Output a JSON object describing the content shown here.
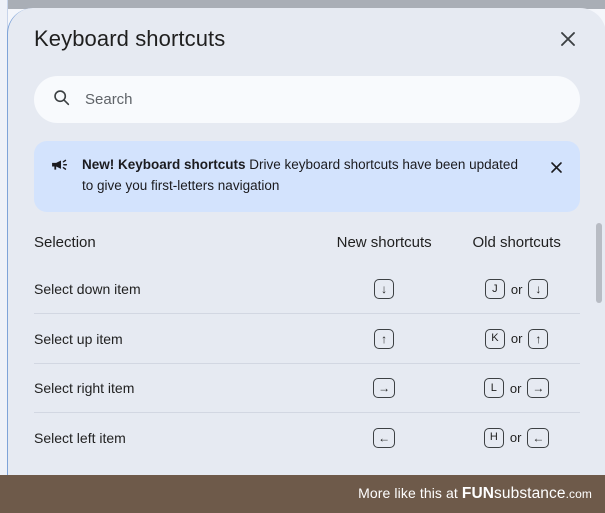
{
  "dialog": {
    "title": "Keyboard shortcuts",
    "close_label": "×",
    "close_icon": "close-icon"
  },
  "search": {
    "placeholder": "Search",
    "value": "",
    "icon": "search-icon"
  },
  "banner": {
    "icon": "campaign-megaphone-icon",
    "headline": "New! Keyboard shortcuts",
    "body": " Drive keyboard shortcuts have been updated to give you first-letters navigation",
    "close_icon": "close-icon",
    "background_color": "#d3e3fd"
  },
  "table": {
    "headers": {
      "selection": "Selection",
      "new_shortcuts": "New shortcuts",
      "old_shortcuts": "Old shortcuts"
    },
    "or_label": "or",
    "rows": [
      {
        "action": "Select down item",
        "new_keys": [
          "↓"
        ],
        "old_keys": [
          "J",
          "↓"
        ]
      },
      {
        "action": "Select up item",
        "new_keys": [
          "↑"
        ],
        "old_keys": [
          "K",
          "↑"
        ]
      },
      {
        "action": "Select right item",
        "new_keys": [
          "→"
        ],
        "old_keys": [
          "L",
          "→"
        ]
      },
      {
        "action": "Select left item",
        "new_keys": [
          "←"
        ],
        "old_keys": [
          "H",
          "←"
        ]
      }
    ]
  },
  "watermark": {
    "prefix": "More like this at ",
    "brand_bold": "FUN",
    "brand_rest": "substance",
    "domain": ".com",
    "background_color": "#6e5a4a"
  },
  "colors": {
    "dialog_background": "#e6eaf2",
    "search_background": "#f8fafd",
    "banner_background": "#d3e3fd",
    "divider": "#d2d7e2",
    "text_primary": "#1f1f1f"
  }
}
